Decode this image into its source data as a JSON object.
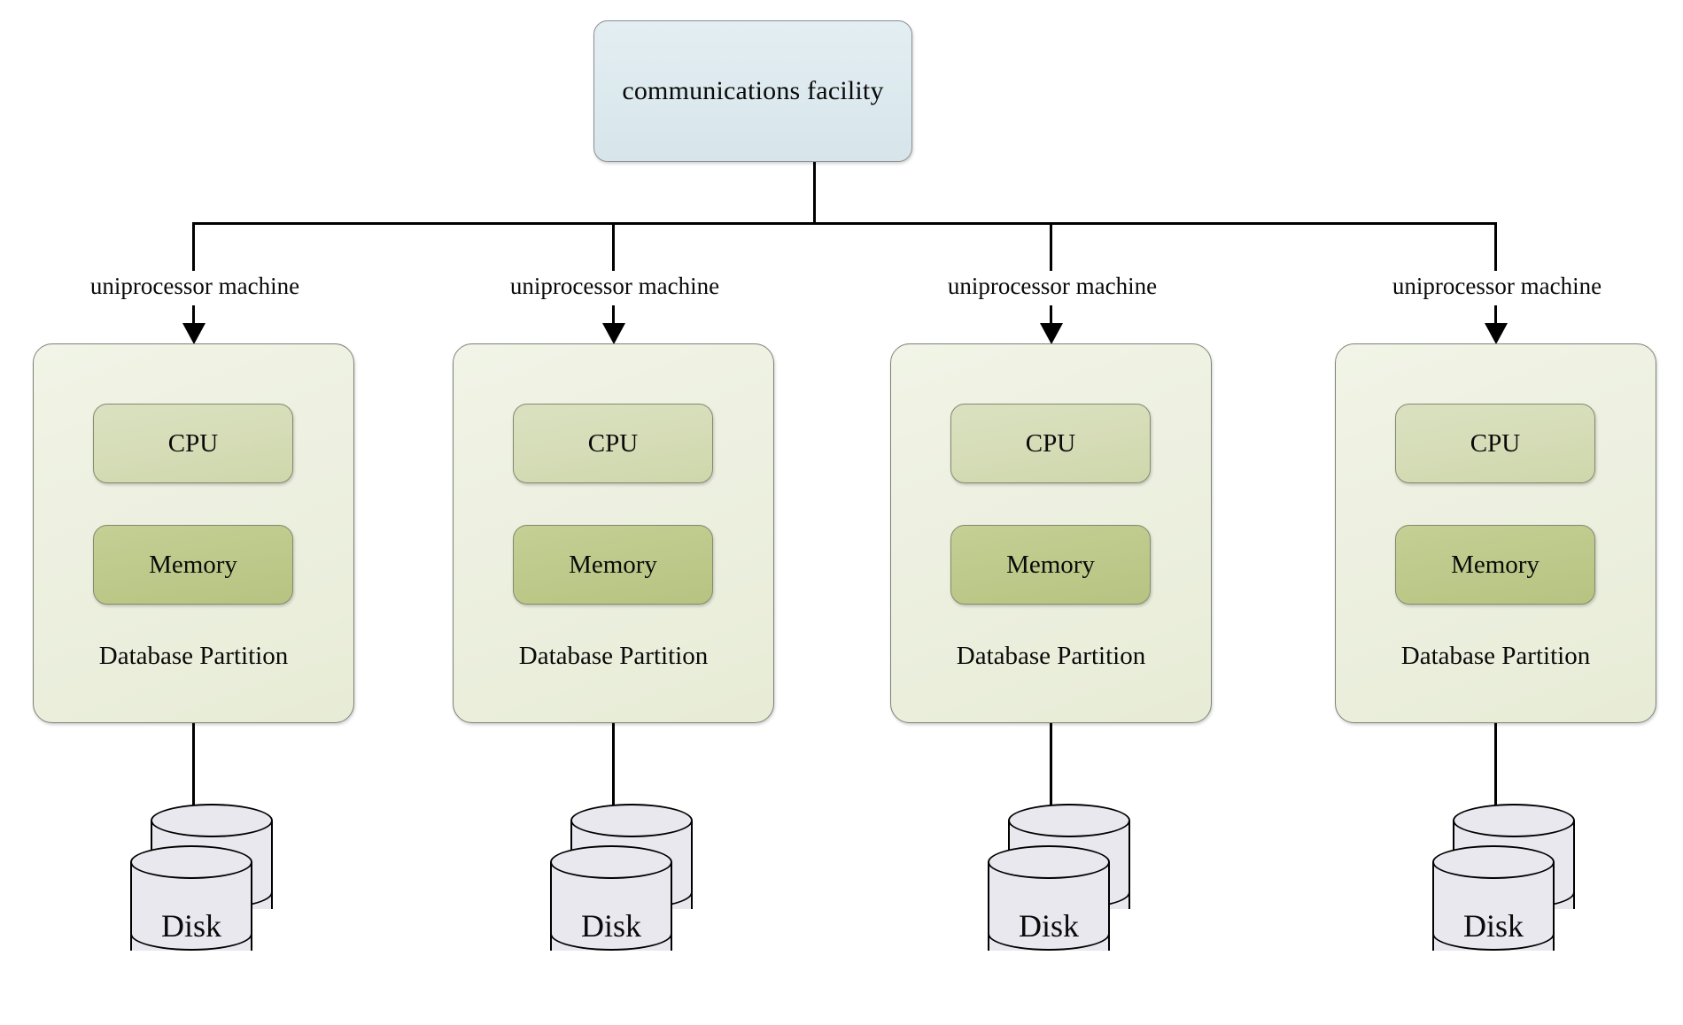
{
  "diagram": {
    "title_node": {
      "label": "communications facility",
      "fill": "#dfeaef",
      "stroke": "#8a8f91"
    },
    "edge_label": "uniprocessor machine",
    "node_labels": {
      "cpu": "CPU",
      "memory": "Memory",
      "partition": "Database Partition",
      "disk": "Disk"
    },
    "colors": {
      "comm_fill": "#dfeaef",
      "partition_fill": "#edf0e0",
      "cpu_fill": "#d5dcb6",
      "memory_fill": "#bdc98a",
      "disk_fill": "#e9e8ef",
      "line": "#000000"
    },
    "branches": [
      {
        "id": "branch-1",
        "edge_label": "uniprocessor machine",
        "cpu": "CPU",
        "memory": "Memory",
        "partition": "Database Partition",
        "disk": "Disk"
      },
      {
        "id": "branch-2",
        "edge_label": "uniprocessor machine",
        "cpu": "CPU",
        "memory": "Memory",
        "partition": "Database Partition",
        "disk": "Disk"
      },
      {
        "id": "branch-3",
        "edge_label": "uniprocessor machine",
        "cpu": "CPU",
        "memory": "Memory",
        "partition": "Database Partition",
        "disk": "Disk"
      },
      {
        "id": "branch-4",
        "edge_label": "uniprocessor machine",
        "cpu": "CPU",
        "memory": "Memory",
        "partition": "Database Partition",
        "disk": "Disk"
      }
    ]
  }
}
